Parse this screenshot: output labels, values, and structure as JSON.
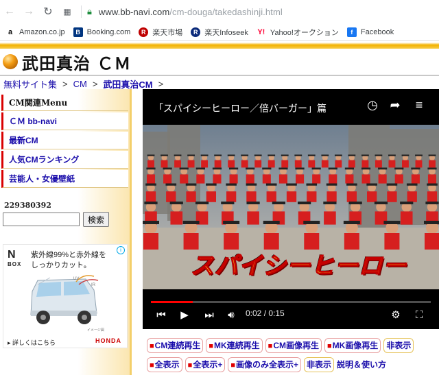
{
  "browser": {
    "url_host": "www.bb-navi.com",
    "url_path": "/cm-douga/takedashinji.html",
    "bookmarks": [
      {
        "icon": "amazon-icon",
        "label": "Amazon.co.jp",
        "color": "#111111"
      },
      {
        "icon": "booking-icon",
        "label": "Booking.com",
        "color": "#003580"
      },
      {
        "icon": "rakuten-icon",
        "label": "楽天市場",
        "color": "#bf0000"
      },
      {
        "icon": "rakuten-infoseek-icon",
        "label": "楽天Infoseek",
        "color": "#0b2a7a"
      },
      {
        "icon": "yahoo-icon",
        "label": "Yahoo!オークション",
        "color": "#ff0033"
      },
      {
        "icon": "facebook-icon",
        "label": "Facebook",
        "color": "#1877f2"
      }
    ]
  },
  "page": {
    "title": "武田真治 ＣＭ",
    "breadcrumb": [
      {
        "label": "無料サイト集"
      },
      {
        "label": "CM"
      },
      {
        "label": "武田真治CM"
      }
    ],
    "breadcrumb_sep": ">"
  },
  "sidebar": {
    "menu_heading": "CM関連Menu",
    "items": [
      "ＣＭ bb-navi",
      "最新CM",
      "人気CMランキング",
      "芸能人・女優壁紙"
    ],
    "counter": "229380392",
    "search_value": "",
    "search_button": "検索"
  },
  "ad": {
    "logo": "N",
    "logo_sub": "BOX",
    "text_line1": "紫外線99%と赤外線を",
    "text_line2": "しっかりカット。",
    "info": "i",
    "car_label": "イメージ図",
    "uv_label": "UV",
    "ir_label": "IR",
    "link": "詳しくはこちら",
    "brand": "HONDA"
  },
  "video": {
    "title": "「スパイシーヒーロー／倍バーガー」篇",
    "caption": "スパイシーヒーロー",
    "time": "0:02 / 0:15",
    "progress": 0.15
  },
  "controls": {
    "row1": [
      {
        "label": "CM連続再生",
        "square": true
      },
      {
        "label": "MK連続再生",
        "square": true
      },
      {
        "label": "CM画像再生",
        "square": true
      },
      {
        "label": "MK画像再生",
        "square": true
      },
      {
        "label": "非表示",
        "square": false
      }
    ],
    "row2": [
      {
        "label": "全表示",
        "square": true
      },
      {
        "label": "全表示+",
        "square": true
      },
      {
        "label": "画像のみ全表示+",
        "square": true
      },
      {
        "label": "非表示",
        "square": false
      }
    ],
    "note": "説明＆使い方",
    "square_glyph": "■"
  }
}
